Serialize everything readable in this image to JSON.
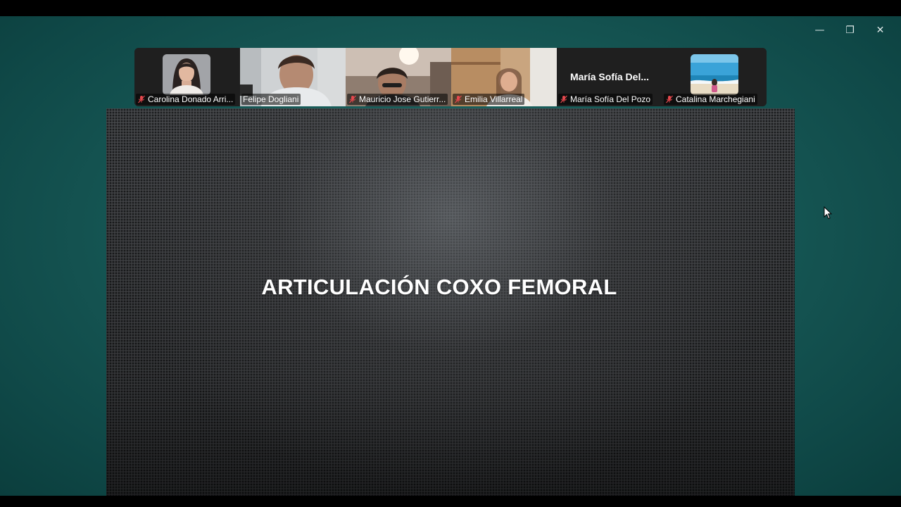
{
  "window": {
    "controls": {
      "minimize": "—",
      "restore": "❐",
      "close": "✕"
    }
  },
  "participants": [
    {
      "name": "Carolina Donado Arri...",
      "muted": true,
      "type": "avatar",
      "avatar": "woman-portrait"
    },
    {
      "name": "Felipe Dogliani",
      "muted": false,
      "type": "video",
      "active_speaker": true
    },
    {
      "name": "Mauricio Jose Gutierr...",
      "muted": true,
      "type": "video"
    },
    {
      "name": "Emilia Villarreal",
      "muted": true,
      "type": "video"
    },
    {
      "name": "María Sofía Del Pozo",
      "muted": true,
      "type": "name-only",
      "display_name": "María Sofía Del..."
    },
    {
      "name": "Catalina Marchegiani",
      "muted": true,
      "type": "avatar",
      "avatar": "beach-photo"
    }
  ],
  "share": {
    "slide_title": "ARTICULACIÓN COXO FEMORAL"
  },
  "colors": {
    "app_background": "#185b58",
    "active_speaker_border": "#34d058",
    "muted_mic": "#e5484d"
  }
}
